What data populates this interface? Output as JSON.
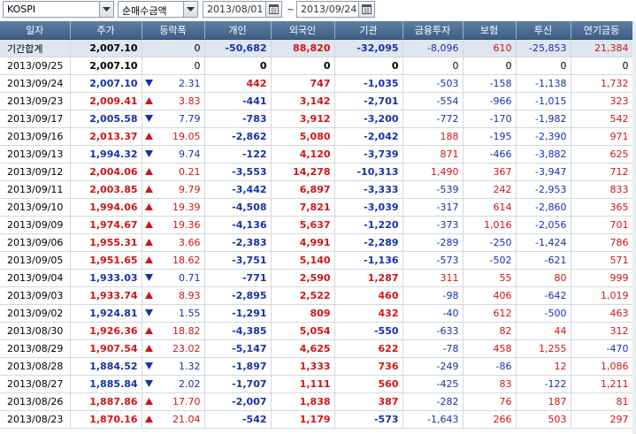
{
  "toolbar": {
    "market": "KOSPI",
    "metric": "순매수금액",
    "date_from": "2013/08/01",
    "date_sep": "~",
    "date_to": "2013/09/24"
  },
  "columns": [
    "일자",
    "주가",
    "등락폭",
    "개인",
    "외국인",
    "기관",
    "금융투자",
    "보험",
    "투신",
    "연기금등"
  ],
  "total": {
    "label": "기간합계",
    "price": "2,007.10",
    "change": "0",
    "individual": "-50,682",
    "foreign": "88,820",
    "institution": "-32,095",
    "fin_invest": "-8,096",
    "insurance": "610",
    "trust": "-25,853",
    "pension": "21,384"
  },
  "rows": [
    {
      "date": "2013/09/25",
      "price": "2,007.10",
      "dir": "none",
      "change": "0",
      "individual": "0",
      "foreign": "0",
      "institution": "0",
      "fin_invest": "0",
      "insurance": "0",
      "trust": "0",
      "pension": "0"
    },
    {
      "date": "2013/09/24",
      "price": "2,007.10",
      "dir": "down",
      "change": "2.31",
      "individual": "442",
      "foreign": "747",
      "institution": "-1,035",
      "fin_invest": "-503",
      "insurance": "-158",
      "trust": "-1,138",
      "pension": "1,732"
    },
    {
      "date": "2013/09/23",
      "price": "2,009.41",
      "dir": "up",
      "change": "3.83",
      "individual": "-441",
      "foreign": "3,142",
      "institution": "-2,701",
      "fin_invest": "-554",
      "insurance": "-966",
      "trust": "-1,015",
      "pension": "323"
    },
    {
      "date": "2013/09/17",
      "price": "2,005.58",
      "dir": "down",
      "change": "7.79",
      "individual": "-783",
      "foreign": "3,912",
      "institution": "-3,200",
      "fin_invest": "-772",
      "insurance": "-170",
      "trust": "-1,982",
      "pension": "542"
    },
    {
      "date": "2013/09/16",
      "price": "2,013.37",
      "dir": "up",
      "change": "19.05",
      "individual": "-2,862",
      "foreign": "5,080",
      "institution": "-2,042",
      "fin_invest": "188",
      "insurance": "-195",
      "trust": "-2,390",
      "pension": "971"
    },
    {
      "date": "2013/09/13",
      "price": "1,994.32",
      "dir": "down",
      "change": "9.74",
      "individual": "-122",
      "foreign": "4,120",
      "institution": "-3,739",
      "fin_invest": "871",
      "insurance": "-466",
      "trust": "-3,882",
      "pension": "625"
    },
    {
      "date": "2013/09/12",
      "price": "2,004.06",
      "dir": "up",
      "change": "0.21",
      "individual": "-3,553",
      "foreign": "14,278",
      "institution": "-10,313",
      "fin_invest": "1,490",
      "insurance": "367",
      "trust": "-3,947",
      "pension": "712"
    },
    {
      "date": "2013/09/11",
      "price": "2,003.85",
      "dir": "up",
      "change": "9.79",
      "individual": "-3,442",
      "foreign": "6,897",
      "institution": "-3,333",
      "fin_invest": "-539",
      "insurance": "242",
      "trust": "-2,953",
      "pension": "833"
    },
    {
      "date": "2013/09/10",
      "price": "1,994.06",
      "dir": "up",
      "change": "19.39",
      "individual": "-4,508",
      "foreign": "7,821",
      "institution": "-3,039",
      "fin_invest": "-317",
      "insurance": "614",
      "trust": "-2,860",
      "pension": "365"
    },
    {
      "date": "2013/09/09",
      "price": "1,974.67",
      "dir": "up",
      "change": "19.36",
      "individual": "-4,136",
      "foreign": "5,637",
      "institution": "-1,220",
      "fin_invest": "-373",
      "insurance": "1,016",
      "trust": "-2,056",
      "pension": "701"
    },
    {
      "date": "2013/09/06",
      "price": "1,955.31",
      "dir": "up",
      "change": "3.66",
      "individual": "-2,383",
      "foreign": "4,991",
      "institution": "-2,289",
      "fin_invest": "-289",
      "insurance": "-250",
      "trust": "-1,424",
      "pension": "786"
    },
    {
      "date": "2013/09/05",
      "price": "1,951.65",
      "dir": "up",
      "change": "18.62",
      "individual": "-3,751",
      "foreign": "5,140",
      "institution": "-1,136",
      "fin_invest": "-573",
      "insurance": "-502",
      "trust": "-621",
      "pension": "571"
    },
    {
      "date": "2013/09/04",
      "price": "1,933.03",
      "dir": "down",
      "change": "0.71",
      "individual": "-771",
      "foreign": "2,590",
      "institution": "1,287",
      "fin_invest": "311",
      "insurance": "55",
      "trust": "80",
      "pension": "999"
    },
    {
      "date": "2013/09/03",
      "price": "1,933.74",
      "dir": "up",
      "change": "8.93",
      "individual": "-2,895",
      "foreign": "2,522",
      "institution": "460",
      "fin_invest": "-98",
      "insurance": "406",
      "trust": "-642",
      "pension": "1,019"
    },
    {
      "date": "2013/09/02",
      "price": "1,924.81",
      "dir": "down",
      "change": "1.55",
      "individual": "-1,291",
      "foreign": "809",
      "institution": "432",
      "fin_invest": "-40",
      "insurance": "612",
      "trust": "-500",
      "pension": "463"
    },
    {
      "date": "2013/08/30",
      "price": "1,926.36",
      "dir": "up",
      "change": "18.82",
      "individual": "-4,385",
      "foreign": "5,054",
      "institution": "-550",
      "fin_invest": "-633",
      "insurance": "82",
      "trust": "44",
      "pension": "312"
    },
    {
      "date": "2013/08/29",
      "price": "1,907.54",
      "dir": "up",
      "change": "23.02",
      "individual": "-5,147",
      "foreign": "4,625",
      "institution": "622",
      "fin_invest": "-78",
      "insurance": "458",
      "trust": "1,255",
      "pension": "-470"
    },
    {
      "date": "2013/08/28",
      "price": "1,884.52",
      "dir": "down",
      "change": "1.32",
      "individual": "-1,897",
      "foreign": "1,333",
      "institution": "736",
      "fin_invest": "-249",
      "insurance": "-86",
      "trust": "12",
      "pension": "1,086"
    },
    {
      "date": "2013/08/27",
      "price": "1,885.84",
      "dir": "down",
      "change": "2.02",
      "individual": "-1,707",
      "foreign": "1,111",
      "institution": "560",
      "fin_invest": "-425",
      "insurance": "83",
      "trust": "-122",
      "pension": "1,211"
    },
    {
      "date": "2013/08/26",
      "price": "1,887.86",
      "dir": "up",
      "change": "17.70",
      "individual": "-2,007",
      "foreign": "1,838",
      "institution": "387",
      "fin_invest": "-282",
      "insurance": "76",
      "trust": "187",
      "pension": "81"
    },
    {
      "date": "2013/08/23",
      "price": "1,870.16",
      "dir": "up",
      "change": "21.04",
      "individual": "-542",
      "foreign": "1,179",
      "institution": "-573",
      "fin_invest": "-1,643",
      "insurance": "266",
      "trust": "503",
      "pension": "297"
    }
  ],
  "colors": {
    "positive": "#d11414",
    "negative": "#1432a8",
    "header_bg": "#4a6a92",
    "total_bg": "#dfe6f0"
  },
  "icons": {
    "dropdown": "chevron-down-icon",
    "calendar": "calendar-icon",
    "up": "triangle-up-icon",
    "down": "triangle-down-icon"
  }
}
